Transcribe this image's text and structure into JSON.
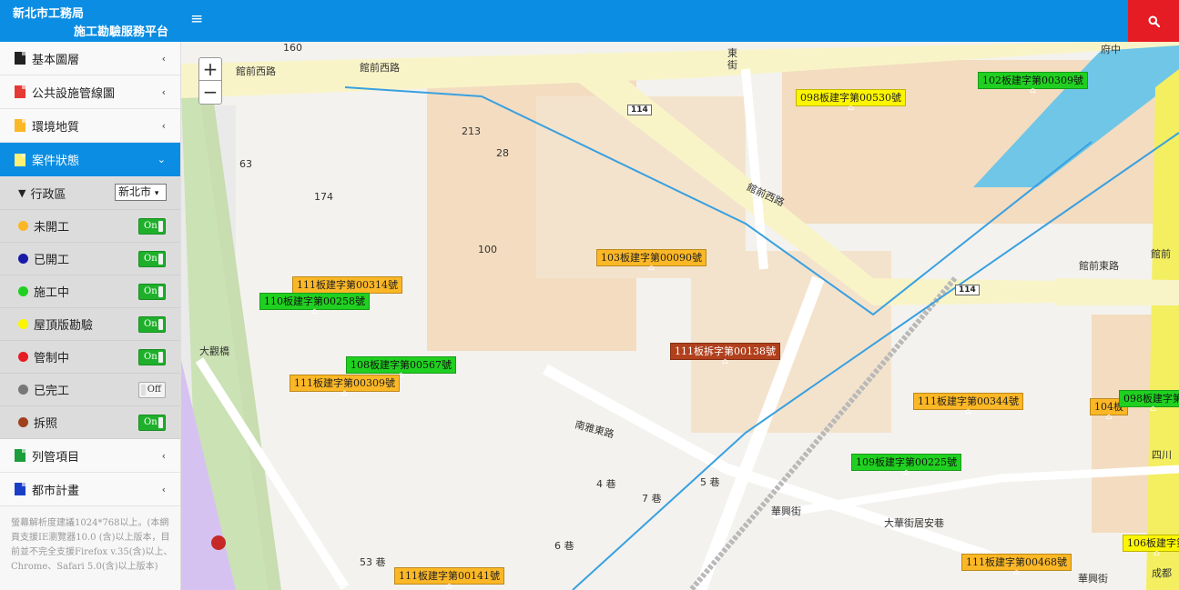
{
  "header": {
    "title_line1": "新北市工務局",
    "title_line2": "施工勘驗服務平台",
    "menu_icon": "hamburger-icon",
    "search_icon": "search-icon",
    "color": "#0a8de3",
    "search_color": "#e51c23"
  },
  "sidebar": {
    "items_top": [
      {
        "label": "基本圖層",
        "icon_color": "#222222"
      },
      {
        "label": "公共設施管線圖",
        "icon_color": "#e53935"
      },
      {
        "label": "環境地質",
        "icon_color": "#fbb725"
      }
    ],
    "active": {
      "label": "案件狀態",
      "icon_color": "#fff176"
    },
    "district": {
      "label": "行政區",
      "value": "新北市"
    },
    "statuses": [
      {
        "label": "未開工",
        "color": "#fbb725",
        "state": "On"
      },
      {
        "label": "已開工",
        "color": "#1a1aa8",
        "state": "On"
      },
      {
        "label": "施工中",
        "color": "#20d020",
        "state": "On"
      },
      {
        "label": "屋頂版勘驗",
        "color": "#fcf500",
        "state": "On"
      },
      {
        "label": "管制中",
        "color": "#e51c23",
        "state": "On"
      },
      {
        "label": "已完工",
        "color": "#777777",
        "state": "Off"
      },
      {
        "label": "拆照",
        "color": "#a0401d",
        "state": "On"
      }
    ],
    "items_bottom": [
      {
        "label": "列管項目",
        "icon_color": "#1b9e3b"
      },
      {
        "label": "都市計畫",
        "icon_color": "#1a3fc7"
      }
    ],
    "note": "螢幕解析度建議1024*768以上。(本網頁支援IE瀏覽器10.0 (含)以上版本，目前並不完全支援Firefox v.35(含)以上、Chrome、Safari 5.0(含)以上版本)"
  },
  "map": {
    "zoom_in": "+",
    "zoom_out": "−",
    "highway": "114",
    "markers": [
      {
        "text": "102板建字第00309號",
        "color": "green"
      },
      {
        "text": "098板建字第00530號",
        "color": "yellow"
      },
      {
        "text": "103板建字第00090號",
        "color": "orange"
      },
      {
        "text": "111板建字第00314號",
        "color": "orange"
      },
      {
        "text": "110板建字第00258號",
        "color": "green"
      },
      {
        "text": "108板建字第00567號",
        "color": "green"
      },
      {
        "text": "111板建字第00309號",
        "color": "orange"
      },
      {
        "text": "111板拆字第00138號",
        "color": "red"
      },
      {
        "text": "111板建字第00344號",
        "color": "orange"
      },
      {
        "text": "104板",
        "color": "orange"
      },
      {
        "text": "098板建字第",
        "color": "green"
      },
      {
        "text": "109板建字第00225號",
        "color": "green"
      },
      {
        "text": "106板建字第",
        "color": "yellow"
      },
      {
        "text": "111板建字第00468號",
        "color": "orange"
      },
      {
        "text": "111板建字第00141號",
        "color": "orange"
      }
    ],
    "labels": {
      "guanqian_w1": "館前西路",
      "guanqian_w2": "館前西路",
      "guanqian_w3": "館前西路",
      "guanqian_e": "館前東路",
      "guanqian_e2": "館前",
      "dagong": "大觀橋",
      "dahua": "大華街居安巷",
      "nanya_e": "南雅東路",
      "huaxing": "華興街",
      "huaxing2": "華興街",
      "dong_jie": "東街",
      "alley_5": "5 巷",
      "alley_7": "7 巷",
      "alley_6": "6 巷",
      "alley_53": "53 巷",
      "alley_100": "100",
      "alley_4": "4 巷",
      "alley_28": "28",
      "alley_213": "213",
      "alley_174": "174",
      "alley_63": "63",
      "alley_160": "160",
      "fuzhong": "府中",
      "sichuan": "四川",
      "chengdu": "成都"
    }
  }
}
